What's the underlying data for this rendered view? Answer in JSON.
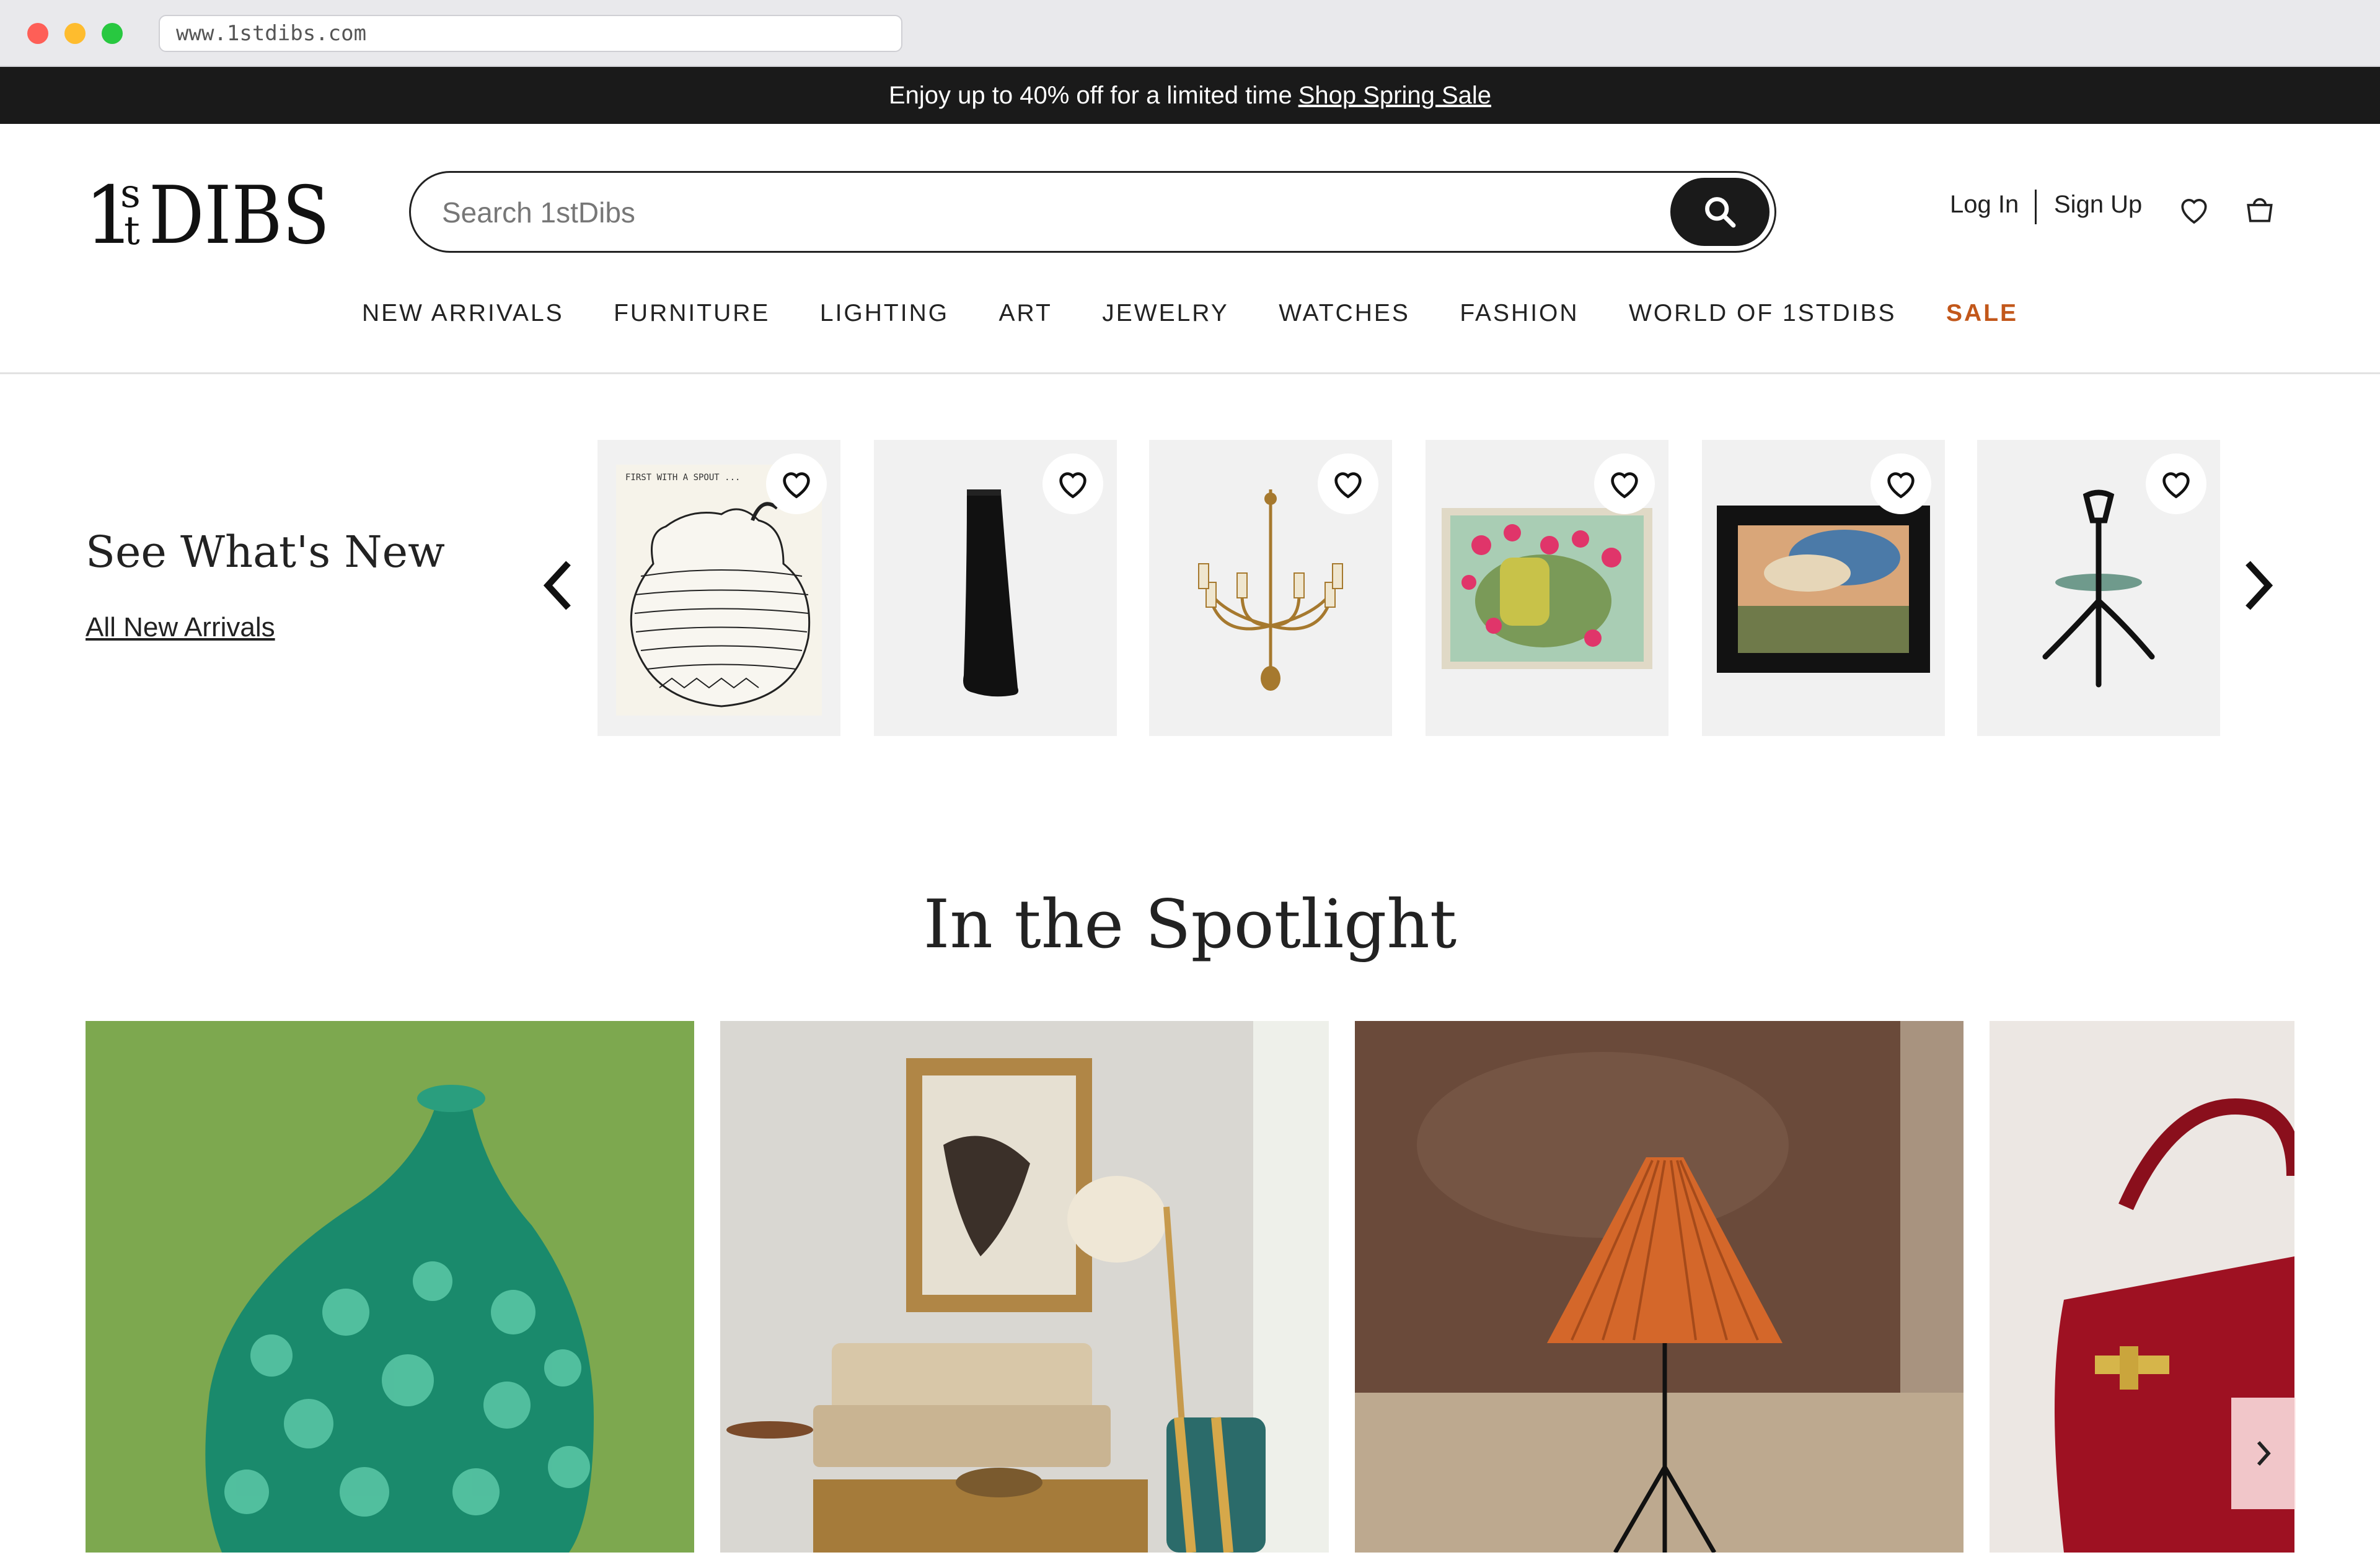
{
  "browser": {
    "url": "www.1stdibs.com"
  },
  "promo": {
    "text": "Enjoy up to 40% off for a limited time",
    "link": "Shop Spring Sale"
  },
  "header": {
    "logo_text": "1stDIBS",
    "search_placeholder": "Search 1stDibs",
    "login": "Log In",
    "signup": "Sign Up"
  },
  "nav": [
    "NEW ARRIVALS",
    "FURNITURE",
    "LIGHTING",
    "ART",
    "JEWELRY",
    "WATCHES",
    "FASHION",
    "WORLD OF 1STDIBS",
    "SALE"
  ],
  "new_arrivals": {
    "title": "See What's New",
    "link": "All New Arrivals",
    "items": [
      "drawing-of-vase",
      "black-skirt",
      "brass-chandelier",
      "floral-still-life-painting",
      "landscape-painting",
      "tripod-side-table"
    ]
  },
  "spotlight": {
    "title": "In the Spotlight",
    "items": [
      "green-glass-vase",
      "living-room-interior",
      "pleated-orange-lamp",
      "red-leather-handbag"
    ]
  },
  "colors": {
    "sale": "#c2571a",
    "banner": "#1a1a1a"
  }
}
